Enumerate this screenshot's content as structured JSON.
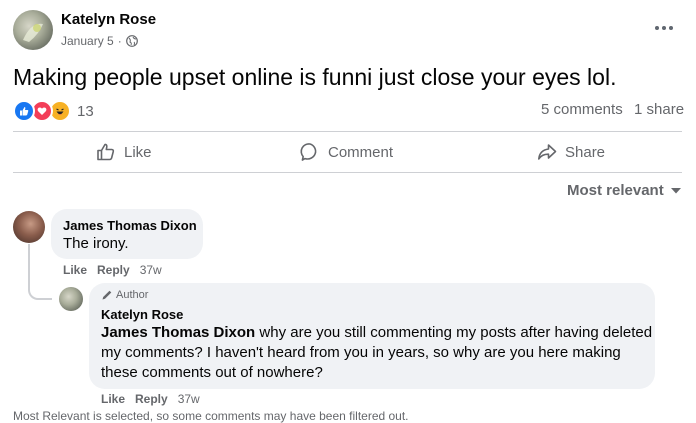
{
  "post": {
    "author": "Katelyn Rose",
    "date": "January 5",
    "privacy_icon": "globe-icon",
    "text": "Making people upset online is funni just close your eyes lol.",
    "reaction_count": "13",
    "comments_count": "5 comments",
    "shares_count": "1 share"
  },
  "actions": {
    "like": "Like",
    "comment": "Comment",
    "share": "Share"
  },
  "sort": {
    "label": "Most relevant"
  },
  "comments": [
    {
      "author": "James Thomas Dixon",
      "text": "The irony.",
      "like": "Like",
      "reply": "Reply",
      "time": "37w"
    }
  ],
  "reply": {
    "badge": "Author",
    "author": "Katelyn Rose",
    "mention": "James Thomas Dixon",
    "text_line1": "why are you still commenting my posts after having deleted",
    "text_line2": "my comments? I haven't heard from you in years, so why are you here making",
    "text_line3": "these comments out of nowhere?",
    "like": "Like",
    "reply": "Reply",
    "time": "37w"
  },
  "footer_note": "Most Relevant is selected, so some comments may have been filtered out.",
  "colors": {
    "like_blue": "#1877f2",
    "love_red": "#f33e58",
    "haha_yellow": "#f7b125",
    "text": "#050505",
    "muted": "#65676b"
  }
}
